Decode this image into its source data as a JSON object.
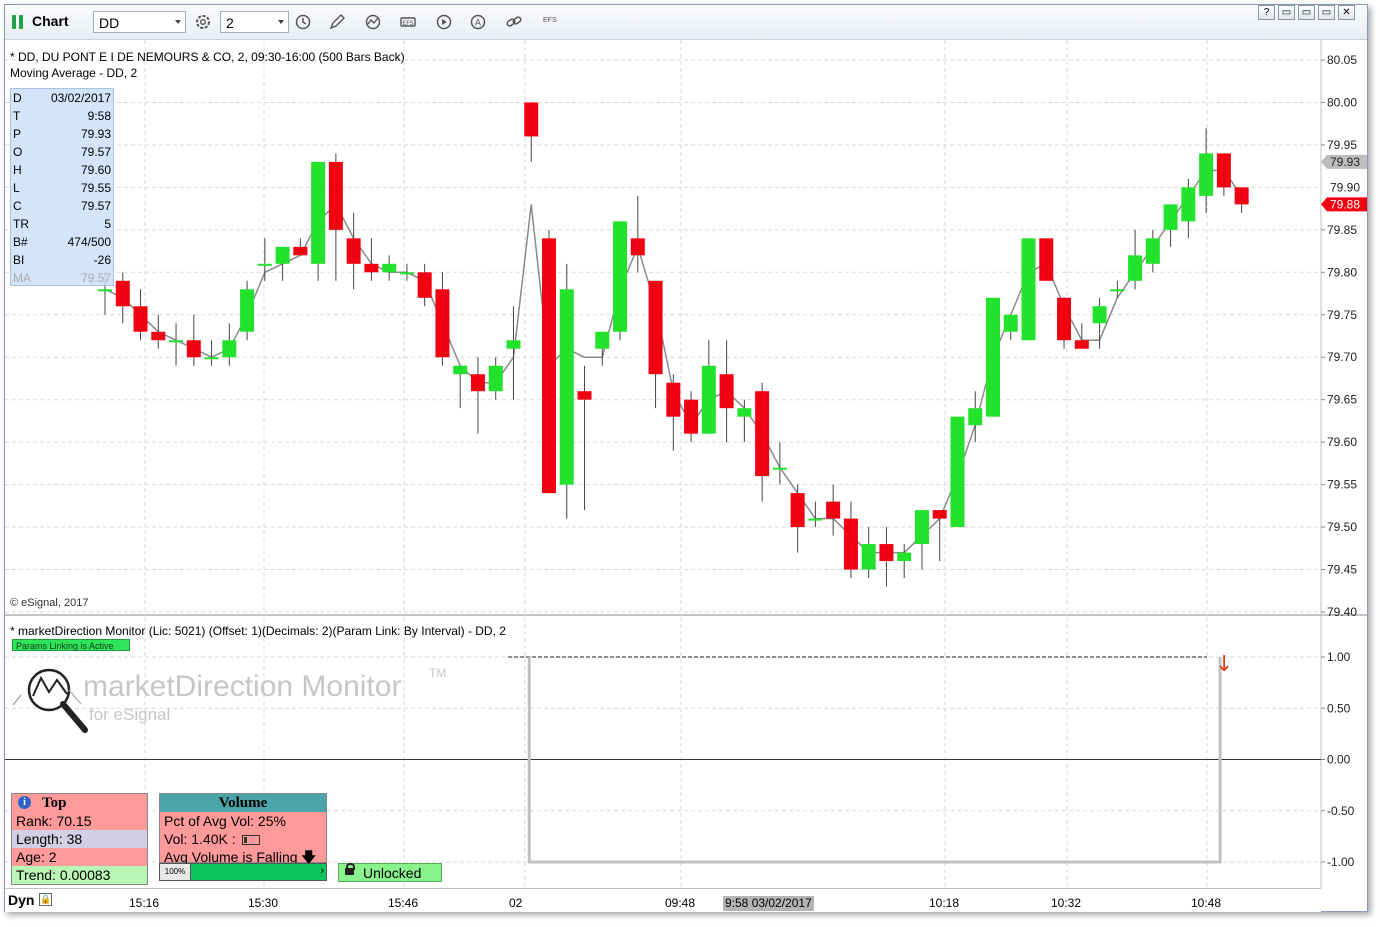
{
  "app": {
    "title": "Chart",
    "symbol": "DD",
    "interval": "2",
    "window_buttons": [
      "?",
      "▭",
      "▭",
      "✕"
    ]
  },
  "toolbar": {
    "icons": [
      "settings-icon",
      "clock-icon",
      "pencil-icon",
      "study-icon",
      "efs-icon",
      "play-icon",
      "alert-icon",
      "link-icon"
    ],
    "efs_label": "EFS"
  },
  "price_pane": {
    "title": "* DD, DU PONT E I DE NEMOURS & CO, 2, 09:30-16:00 (500 Bars Back)",
    "study_label": "Moving Average - DD, 2",
    "copyright": "© eSignal, 2017",
    "y_ticks": [
      "80.05",
      "80.00",
      "79.95",
      "79.90",
      "79.85",
      "79.80",
      "79.75",
      "79.70",
      "79.65",
      "79.60",
      "79.55",
      "79.50",
      "79.45",
      "79.40"
    ],
    "last_price_tag": "79.93",
    "ma_price_tag": "79.88",
    "partial_tag": "79.90",
    "colors": {
      "up": "#22e22c",
      "down": "#f00010",
      "ma": "#8a8a8a",
      "grid": "#d9d9d9"
    }
  },
  "data_window": {
    "rows": [
      {
        "k": "D",
        "v": "03/02/2017"
      },
      {
        "k": "T",
        "v": "9:58"
      },
      {
        "k": "P",
        "v": "79.93"
      },
      {
        "k": "O",
        "v": "79.57"
      },
      {
        "k": "H",
        "v": "79.60"
      },
      {
        "k": "L",
        "v": "79.55"
      },
      {
        "k": "C",
        "v": "79.57"
      },
      {
        "k": "TR",
        "v": "5"
      },
      {
        "k": "B#",
        "v": "474/500"
      },
      {
        "k": "BI",
        "v": "-26"
      },
      {
        "k": "MA",
        "v": "79.57"
      }
    ]
  },
  "indicator_pane": {
    "title": "* marketDirection Monitor (Lic: 5021) (Offset: 1)(Decimals: 2)(Param Link: By Interval) - DD, 2",
    "params_badge": "Params Linking is Active",
    "watermark_title": "marketDirection Monitor",
    "watermark_tm": "TM",
    "watermark_sub": "for eSignal",
    "y_ticks": [
      "1.00",
      "0.50",
      "0.00",
      "-0.50",
      "-1.00"
    ]
  },
  "top_panel": {
    "header": "Top",
    "rank": "Rank: 70.15",
    "length": "Length: 38",
    "age": "Age: 2",
    "trend": "Trend: 0.00083"
  },
  "volume_panel": {
    "header": "Volume",
    "pct": "Pct of Avg Vol: 25%",
    "vol": "Vol: 1.40K :",
    "falling": "Avg Volume is Falling",
    "bar_pct": "100%",
    "bar_level": 1.0
  },
  "lock_button": {
    "label": "Unlocked"
  },
  "x_axis": {
    "mode": "Dyn",
    "labels": [
      "15:16",
      "15:30",
      "15:46",
      "02",
      "09:48",
      "10:18",
      "10:32",
      "10:48"
    ],
    "cursor_label": "9:58 03/02/2017"
  },
  "chart_data": {
    "type": "candlestick",
    "title": "* DD, DU PONT E I DE NEMOURS & CO, 2, 09:30-16:00 (500 Bars Back)",
    "ylim": [
      79.4,
      80.05
    ],
    "bars": [
      {
        "o": 79.78,
        "h": 79.8,
        "l": 79.75,
        "c": 79.78
      },
      {
        "o": 79.79,
        "h": 79.8,
        "l": 79.74,
        "c": 79.76
      },
      {
        "o": 79.76,
        "h": 79.78,
        "l": 79.72,
        "c": 79.73
      },
      {
        "o": 79.73,
        "h": 79.75,
        "l": 79.71,
        "c": 79.72
      },
      {
        "o": 79.72,
        "h": 79.74,
        "l": 79.69,
        "c": 79.72
      },
      {
        "o": 79.72,
        "h": 79.75,
        "l": 79.69,
        "c": 79.7
      },
      {
        "o": 79.7,
        "h": 79.72,
        "l": 79.69,
        "c": 79.7
      },
      {
        "o": 79.7,
        "h": 79.74,
        "l": 79.69,
        "c": 79.72
      },
      {
        "o": 79.73,
        "h": 79.79,
        "l": 79.72,
        "c": 79.78
      },
      {
        "o": 79.81,
        "h": 79.84,
        "l": 79.79,
        "c": 79.81
      },
      {
        "o": 79.81,
        "h": 79.82,
        "l": 79.79,
        "c": 79.83
      },
      {
        "o": 79.83,
        "h": 79.84,
        "l": 79.82,
        "c": 79.82
      },
      {
        "o": 79.81,
        "h": 79.93,
        "l": 79.79,
        "c": 79.93
      },
      {
        "o": 79.93,
        "h": 79.94,
        "l": 79.79,
        "c": 79.85
      },
      {
        "o": 79.84,
        "h": 79.87,
        "l": 79.78,
        "c": 79.81
      },
      {
        "o": 79.81,
        "h": 79.84,
        "l": 79.79,
        "c": 79.8
      },
      {
        "o": 79.8,
        "h": 79.82,
        "l": 79.79,
        "c": 79.81
      },
      {
        "o": 79.8,
        "h": 79.81,
        "l": 79.79,
        "c": 79.8
      },
      {
        "o": 79.8,
        "h": 79.81,
        "l": 79.76,
        "c": 79.77
      },
      {
        "o": 79.78,
        "h": 79.8,
        "l": 79.69,
        "c": 79.7
      },
      {
        "o": 79.68,
        "h": 79.69,
        "l": 79.64,
        "c": 79.69
      },
      {
        "o": 79.68,
        "h": 79.7,
        "l": 79.61,
        "c": 79.66
      },
      {
        "o": 79.66,
        "h": 79.7,
        "l": 79.65,
        "c": 79.69
      },
      {
        "o": 79.71,
        "h": 79.76,
        "l": 79.65,
        "c": 79.72
      },
      {
        "o": 80.0,
        "h": 80.0,
        "l": 79.93,
        "c": 79.96
      },
      {
        "o": 79.84,
        "h": 79.85,
        "l": 79.54,
        "c": 79.54
      },
      {
        "o": 79.55,
        "h": 79.81,
        "l": 79.51,
        "c": 79.78
      },
      {
        "o": 79.66,
        "h": 79.69,
        "l": 79.52,
        "c": 79.65
      },
      {
        "o": 79.71,
        "h": 79.73,
        "l": 79.69,
        "c": 79.73
      },
      {
        "o": 79.73,
        "h": 79.86,
        "l": 79.72,
        "c": 79.86
      },
      {
        "o": 79.84,
        "h": 79.89,
        "l": 79.8,
        "c": 79.82
      },
      {
        "o": 79.79,
        "h": 79.79,
        "l": 79.64,
        "c": 79.68
      },
      {
        "o": 79.67,
        "h": 79.68,
        "l": 79.59,
        "c": 79.63
      },
      {
        "o": 79.65,
        "h": 79.66,
        "l": 79.6,
        "c": 79.61
      },
      {
        "o": 79.61,
        "h": 79.72,
        "l": 79.61,
        "c": 79.69
      },
      {
        "o": 79.68,
        "h": 79.72,
        "l": 79.6,
        "c": 79.64
      },
      {
        "o": 79.63,
        "h": 79.65,
        "l": 79.6,
        "c": 79.64
      },
      {
        "o": 79.66,
        "h": 79.67,
        "l": 79.53,
        "c": 79.56
      },
      {
        "o": 79.57,
        "h": 79.6,
        "l": 79.55,
        "c": 79.57
      },
      {
        "o": 79.54,
        "h": 79.55,
        "l": 79.47,
        "c": 79.5
      },
      {
        "o": 79.51,
        "h": 79.53,
        "l": 79.5,
        "c": 79.51
      },
      {
        "o": 79.53,
        "h": 79.55,
        "l": 79.49,
        "c": 79.51
      },
      {
        "o": 79.51,
        "h": 79.53,
        "l": 79.44,
        "c": 79.45
      },
      {
        "o": 79.45,
        "h": 79.5,
        "l": 79.44,
        "c": 79.48
      },
      {
        "o": 79.48,
        "h": 79.5,
        "l": 79.43,
        "c": 79.46
      },
      {
        "o": 79.46,
        "h": 79.48,
        "l": 79.44,
        "c": 79.47
      },
      {
        "o": 79.48,
        "h": 79.52,
        "l": 79.45,
        "c": 79.52
      },
      {
        "o": 79.52,
        "h": 79.52,
        "l": 79.46,
        "c": 79.51
      },
      {
        "o": 79.5,
        "h": 79.63,
        "l": 79.5,
        "c": 79.63
      },
      {
        "o": 79.62,
        "h": 79.66,
        "l": 79.6,
        "c": 79.64
      },
      {
        "o": 79.63,
        "h": 79.77,
        "l": 79.63,
        "c": 79.77
      },
      {
        "o": 79.73,
        "h": 79.75,
        "l": 79.72,
        "c": 79.75
      },
      {
        "o": 79.72,
        "h": 79.84,
        "l": 79.72,
        "c": 79.84
      },
      {
        "o": 79.84,
        "h": 79.84,
        "l": 79.79,
        "c": 79.79
      },
      {
        "o": 79.77,
        "h": 79.77,
        "l": 79.71,
        "c": 79.72
      },
      {
        "o": 79.72,
        "h": 79.74,
        "l": 79.71,
        "c": 79.71
      },
      {
        "o": 79.74,
        "h": 79.77,
        "l": 79.71,
        "c": 79.76
      },
      {
        "o": 79.78,
        "h": 79.79,
        "l": 79.77,
        "c": 79.78
      },
      {
        "o": 79.79,
        "h": 79.85,
        "l": 79.78,
        "c": 79.82
      },
      {
        "o": 79.81,
        "h": 79.85,
        "l": 79.8,
        "c": 79.84
      },
      {
        "o": 79.85,
        "h": 79.88,
        "l": 79.83,
        "c": 79.88
      },
      {
        "o": 79.86,
        "h": 79.91,
        "l": 79.84,
        "c": 79.9
      },
      {
        "o": 79.89,
        "h": 79.97,
        "l": 79.87,
        "c": 79.94
      },
      {
        "o": 79.94,
        "h": 79.94,
        "l": 79.89,
        "c": 79.9
      },
      {
        "o": 79.9,
        "h": 79.9,
        "l": 79.87,
        "c": 79.88
      }
    ],
    "moving_average": [
      79.78,
      79.77,
      79.75,
      79.73,
      79.72,
      79.71,
      79.7,
      79.71,
      79.75,
      79.8,
      79.81,
      79.82,
      79.86,
      79.88,
      79.84,
      79.81,
      79.8,
      79.8,
      79.79,
      79.74,
      79.69,
      79.67,
      79.67,
      79.7,
      79.88,
      79.69,
      79.71,
      79.7,
      79.7,
      79.78,
      79.83,
      79.76,
      79.66,
      79.62,
      79.65,
      79.66,
      79.64,
      79.61,
      79.57,
      79.54,
      79.51,
      79.51,
      79.49,
      79.47,
      79.47,
      79.47,
      79.49,
      79.51,
      79.56,
      79.62,
      79.7,
      79.75,
      79.8,
      79.81,
      79.76,
      79.72,
      79.72,
      79.77,
      79.8,
      79.83,
      79.86,
      79.89,
      79.92,
      79.92,
      79.89
    ],
    "indicator": {
      "ylim": [
        -1.2,
        1.2
      ],
      "dashed_level": 1.0,
      "step_line": [
        {
          "from_bar": 24,
          "to_bar": 62,
          "value": -1.0
        }
      ],
      "signal": "down"
    }
  }
}
